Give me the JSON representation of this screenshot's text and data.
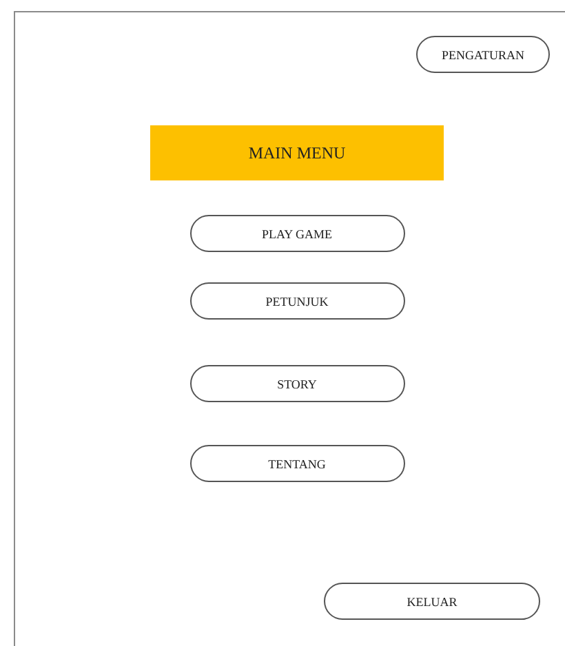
{
  "settings_button": {
    "label": "PENGATURAN"
  },
  "title": "MAIN MENU",
  "menu_buttons": [
    {
      "label": "PLAY GAME"
    },
    {
      "label": "PETUNJUK"
    },
    {
      "label": "STORY"
    },
    {
      "label": "TENTANG"
    }
  ],
  "exit_button": {
    "label": "KELUAR"
  }
}
